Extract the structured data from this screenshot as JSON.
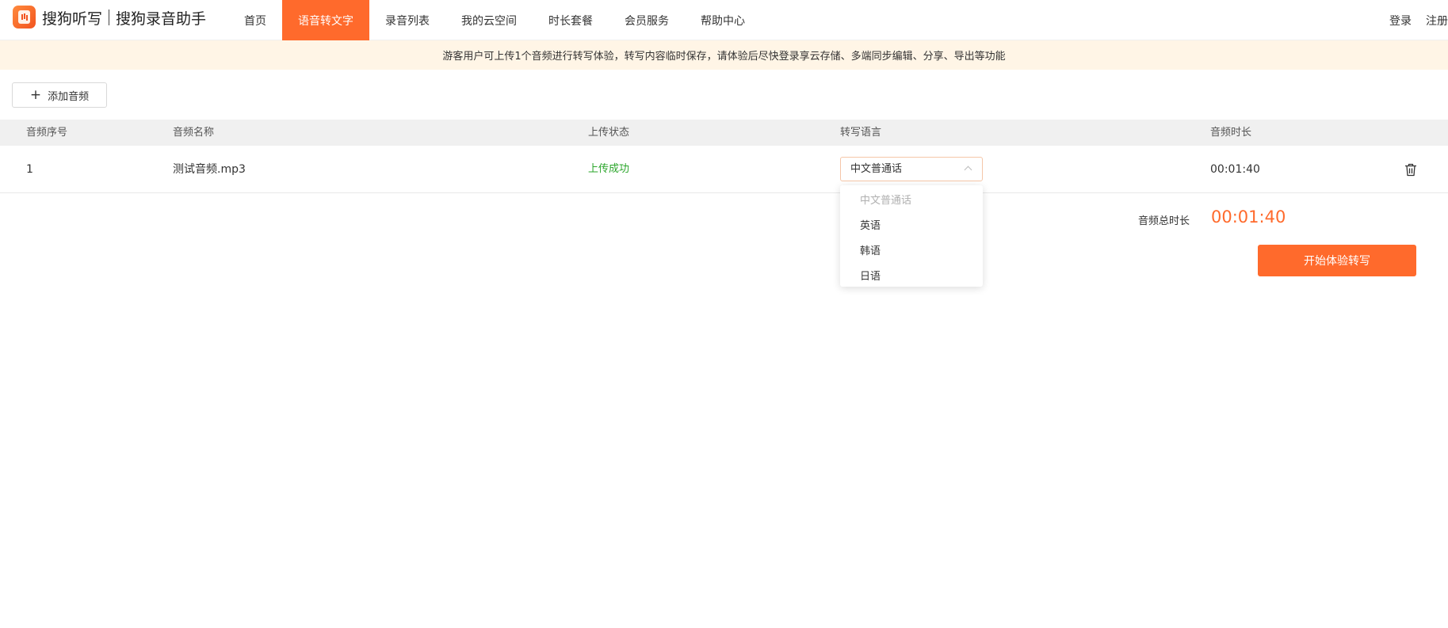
{
  "brand": {
    "name_primary": "搜狗听写",
    "name_secondary": "搜狗录音助手"
  },
  "nav": [
    {
      "label": "首页"
    },
    {
      "label": "语音转文字",
      "active": true
    },
    {
      "label": "录音列表"
    },
    {
      "label": "我的云空间"
    },
    {
      "label": "时长套餐"
    },
    {
      "label": "会员服务"
    },
    {
      "label": "帮助中心"
    }
  ],
  "auth": {
    "login": "登录",
    "register": "注册"
  },
  "notice": "游客用户可上传1个音频进行转写体验，转写内容临时保存，请体验后尽快登录享云存储、多端同步编辑、分享、导出等功能",
  "add_button": {
    "icon": "plus-icon",
    "label": "添加音频"
  },
  "table": {
    "headers": {
      "index": "音频序号",
      "name": "音频名称",
      "status": "上传状态",
      "language": "转写语言",
      "duration": "音频时长"
    },
    "rows": [
      {
        "index": "1",
        "name": "测试音频.mp3",
        "status": "上传成功",
        "language": "中文普通话",
        "duration": "00:01:40"
      }
    ]
  },
  "language_dropdown": {
    "options": [
      "中文普通话",
      "英语",
      "韩语",
      "日语"
    ],
    "selected": "中文普通话"
  },
  "summary": {
    "total_label": "音频总时长",
    "total_value": "00:01:40",
    "start_label": "开始体验转写"
  },
  "colors": {
    "accent": "#ff6a2c",
    "success": "#2aa52a",
    "notice_bg": "#fff5e6"
  }
}
